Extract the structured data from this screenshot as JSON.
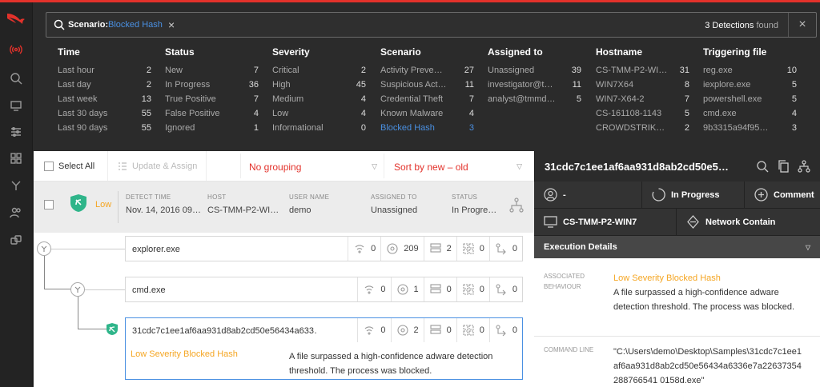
{
  "search": {
    "label": "Scenario:",
    "value": "Blocked Hash",
    "count": "3 Detections",
    "found": "found"
  },
  "facets": [
    {
      "title": "Time",
      "rows": [
        {
          "label": "Last hour",
          "count": "2"
        },
        {
          "label": "Last day",
          "count": "2"
        },
        {
          "label": "Last week",
          "count": "13"
        },
        {
          "label": "Last 30 days",
          "count": "55"
        },
        {
          "label": "Last 90 days",
          "count": "55"
        }
      ]
    },
    {
      "title": "Status",
      "rows": [
        {
          "label": "New",
          "count": "7"
        },
        {
          "label": "In Progress",
          "count": "36"
        },
        {
          "label": "True Positive",
          "count": "7"
        },
        {
          "label": "False Positive",
          "count": "4"
        },
        {
          "label": "Ignored",
          "count": "1"
        }
      ]
    },
    {
      "title": "Severity",
      "rows": [
        {
          "label": "Critical",
          "count": "2"
        },
        {
          "label": "High",
          "count": "45"
        },
        {
          "label": "Medium",
          "count": "4"
        },
        {
          "label": "Low",
          "count": "4"
        },
        {
          "label": "Informational",
          "count": "0"
        }
      ]
    },
    {
      "title": "Scenario",
      "rows": [
        {
          "label": "Activity Preve…",
          "count": "27"
        },
        {
          "label": "Suspicious Act…",
          "count": "11"
        },
        {
          "label": "Credential Theft",
          "count": "7"
        },
        {
          "label": "Known Malware",
          "count": "4"
        },
        {
          "label": "Blocked Hash",
          "count": "3"
        }
      ]
    },
    {
      "title": "Assigned to",
      "rows": [
        {
          "label": "Unassigned",
          "count": "39"
        },
        {
          "label": "investigator@t…",
          "count": "11"
        },
        {
          "label": "analyst@tmmd…",
          "count": "5"
        }
      ]
    },
    {
      "title": "Hostname",
      "rows": [
        {
          "label": "CS-TMM-P2-WI…",
          "count": "31"
        },
        {
          "label": "WIN7X64",
          "count": "8"
        },
        {
          "label": "WIN7-X64-2",
          "count": "7"
        },
        {
          "label": "CS-161108-1143",
          "count": "5"
        },
        {
          "label": "CROWDSTRIK…",
          "count": "2"
        }
      ]
    },
    {
      "title": "Triggering file",
      "rows": [
        {
          "label": "reg.exe",
          "count": "10"
        },
        {
          "label": "iexplore.exe",
          "count": "5"
        },
        {
          "label": "powershell.exe",
          "count": "5"
        },
        {
          "label": "cmd.exe",
          "count": "4"
        },
        {
          "label": "9b3315a94f95…",
          "count": "3"
        }
      ]
    }
  ],
  "toolbar": {
    "select_all": "Select All",
    "update_assign": "Update & Assign",
    "grouping": "No grouping",
    "sort": "Sort by new – old"
  },
  "detection": {
    "severity": "Low",
    "detect_time_label": "DETECT TIME",
    "detect_time": "Nov. 14, 2016 09…",
    "host_label": "HOST",
    "host": "CS-TMM-P2-WI…",
    "user_label": "USER NAME",
    "user": "demo",
    "assigned_label": "ASSIGNED TO",
    "assigned": "Unassigned",
    "status_label": "STATUS",
    "status": "In Progre…"
  },
  "processes": [
    {
      "name": "explorer.exe",
      "stats": [
        "0",
        "209",
        "2",
        "0",
        "0"
      ]
    },
    {
      "name": "cmd.exe",
      "stats": [
        "0",
        "1",
        "0",
        "0",
        "0"
      ]
    },
    {
      "name": "31cdc7c1ee1af6aa931d8ab2cd50e56434a633…",
      "stats": [
        "0",
        "2",
        "0",
        "0",
        "0"
      ],
      "behaviour": "Low Severity Blocked Hash",
      "description": "A file surpassed a high-confidence adware detection threshold. The process was blocked."
    }
  ],
  "detail": {
    "title": "31cdc7c1ee1af6aa931d8ab2cd50e5…",
    "user": "-",
    "status": "In Progress",
    "comment": "Comment",
    "host": "CS-TMM-P2-WIN7",
    "contain": "Network Contain",
    "section": "Execution Details",
    "assoc_label": "ASSOCIATED BEHAVIOUR",
    "assoc_title": "Low Severity Blocked Hash",
    "assoc_text": "A file surpassed a high-confidence adware detection threshold. The process was blocked.",
    "cmd_label": "COMMAND LINE",
    "cmd_value": "\"C:\\Users\\demo\\Desktop\\Samples\\31cdc7c1ee1af6aa931d8ab2cd50e56434a6336e7a22637354288766541 0158d.exe\""
  },
  "colors": {
    "accent": "#e3322b",
    "link": "#4a90e2",
    "warn": "#f5a623",
    "shield": "#2fb58a"
  }
}
